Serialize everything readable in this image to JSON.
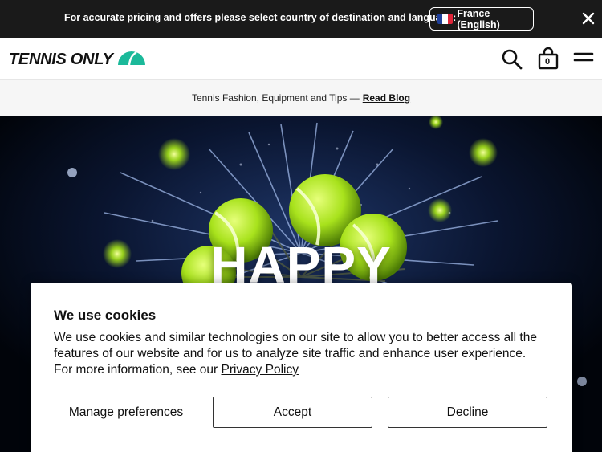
{
  "topbar": {
    "message": "For accurate pricing and offers please select country of destination and language:",
    "country_label": "France (English)",
    "flag_icon": "france-flag-icon",
    "close_icon": "close-icon"
  },
  "header": {
    "logo_text": "TENNIS ONLY",
    "logo_icon": "tennis-ball-logo-icon",
    "search_icon": "search-icon",
    "cart_icon": "shopping-bag-icon",
    "cart_count": "0",
    "menu_icon": "hamburger-menu-icon"
  },
  "promo": {
    "text": "Tennis Fashion, Equipment and Tips —",
    "link": "Read Blog"
  },
  "hero": {
    "title": "HAPPY"
  },
  "cookie_banner": {
    "title": "We use cookies",
    "body": "We use cookies and similar technologies on our site to allow you to better access all the features of our website and for us to analyze site traffic and enhance user experience. For more information, see our",
    "policy_link": "Privacy Policy",
    "manage_label": "Manage preferences",
    "accept_label": "Accept",
    "decline_label": "Decline"
  },
  "colors": {
    "topbar_bg": "#1a1a1a",
    "brand_green": "#1bb99a",
    "ball_green": "#a8e21c"
  }
}
